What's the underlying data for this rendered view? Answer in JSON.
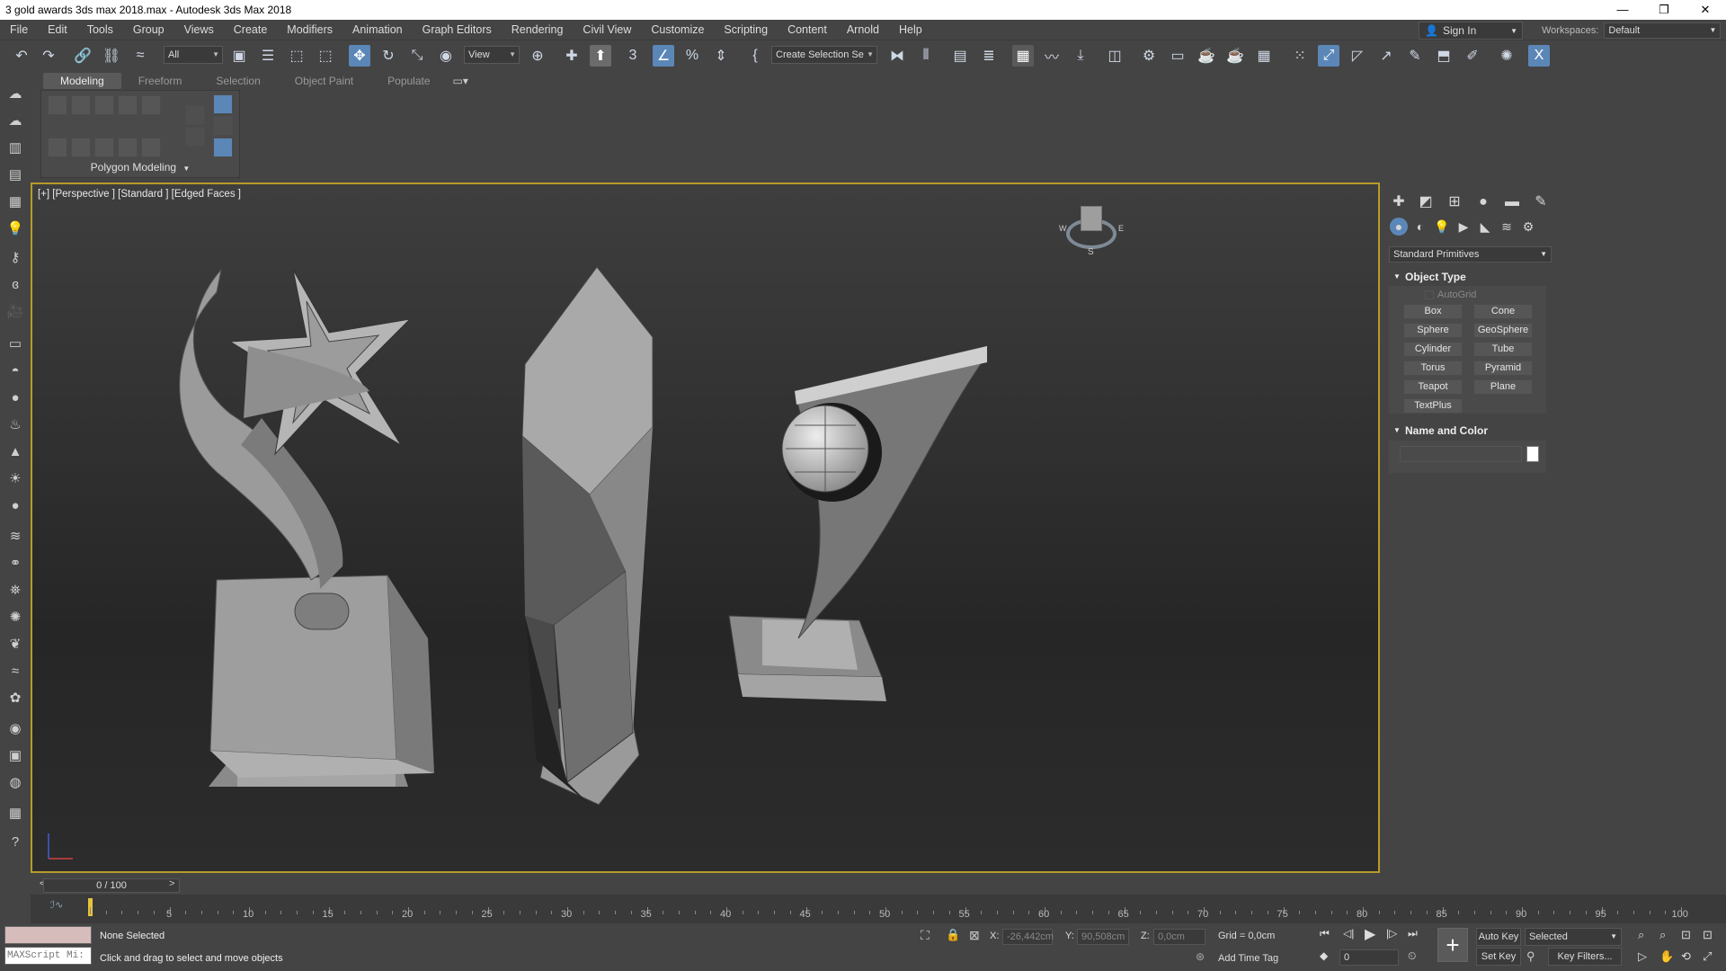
{
  "window": {
    "title": "3 gold awards 3ds max 2018.max - Autodesk 3ds Max 2018",
    "controls": [
      "—",
      "❐",
      "✕"
    ]
  },
  "menu": [
    "File",
    "Edit",
    "Tools",
    "Group",
    "Views",
    "Create",
    "Modifiers",
    "Animation",
    "Graph Editors",
    "Rendering",
    "Civil View",
    "Customize",
    "Scripting",
    "Content",
    "Arnold",
    "Help"
  ],
  "account": {
    "signin": "Sign In",
    "workspaces_label": "Workspaces:",
    "workspace": "Default"
  },
  "toolbar": {
    "filter": "All",
    "ref_coord": "View",
    "selection_set": "Create Selection Se"
  },
  "ribbon": {
    "tabs": [
      "Modeling",
      "Freeform",
      "Selection",
      "Object Paint",
      "Populate"
    ],
    "active_tab": "Modeling",
    "panel_label": "Polygon Modeling"
  },
  "viewport": {
    "label": "[+] [Perspective ] [Standard ] [Edged Faces ]",
    "viewcube_labels": {
      "south": "S",
      "west": "W",
      "east": "E"
    }
  },
  "command_panel": {
    "category": "Standard Primitives",
    "object_type": {
      "title": "Object Type",
      "autogrid": "AutoGrid",
      "buttons": [
        "Box",
        "Cone",
        "Sphere",
        "GeoSphere",
        "Cylinder",
        "Tube",
        "Torus",
        "Pyramid",
        "Teapot",
        "Plane",
        "TextPlus"
      ]
    },
    "name_and_color": {
      "title": "Name and Color",
      "name_value": "",
      "color": "#ffffff"
    }
  },
  "timeline": {
    "frame": "0 / 100",
    "prev": "<",
    "next": ">",
    "ticks": [
      "0",
      "5",
      "10",
      "15",
      "20",
      "25",
      "30",
      "35",
      "40",
      "45",
      "50",
      "55",
      "60",
      "65",
      "70",
      "75",
      "80",
      "85",
      "90",
      "95",
      "100"
    ]
  },
  "status": {
    "maxscript": "MAXScript Mi:",
    "selection": "None Selected",
    "prompt": "Click and drag to select and move objects",
    "x_label": "X:",
    "x": "-26,442cm",
    "y_label": "Y:",
    "y": "90,508cm",
    "z_label": "Z:",
    "z": "0,0cm",
    "grid": "Grid = 0,0cm",
    "add_time_tag": "Add Time Tag",
    "auto_key": "Auto Key",
    "set_key": "Set Key",
    "key_mode": "Selected",
    "key_filters": "Key Filters...",
    "current_frame": "0"
  }
}
